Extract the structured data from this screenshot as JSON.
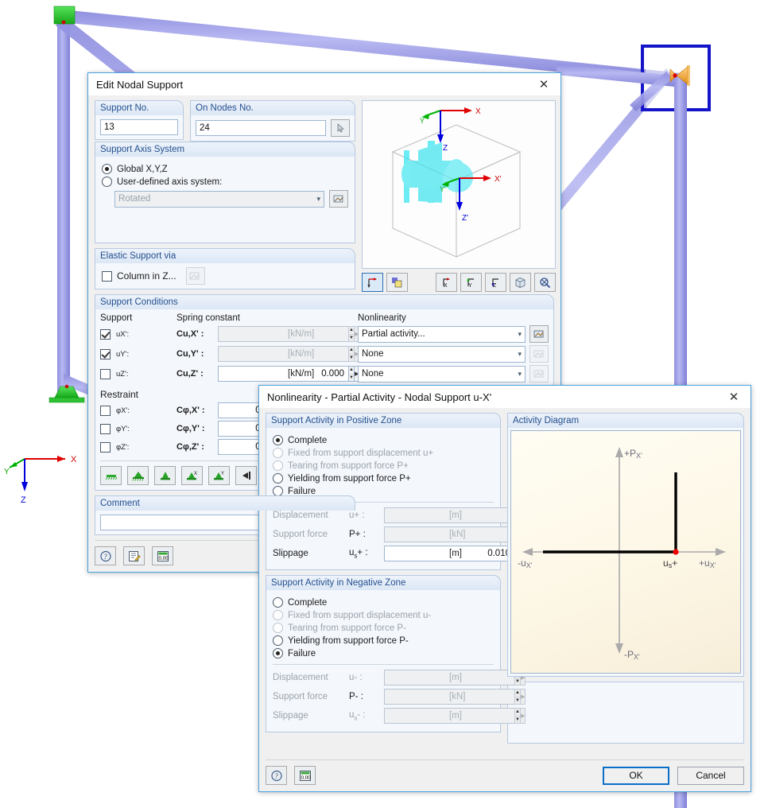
{
  "background": {
    "name": "rfem-3d-model-viewport",
    "axes": {
      "x": "X",
      "y": "Y",
      "z": "Z"
    },
    "member_color": "#9a9ae8",
    "support_color": "#22cc22",
    "highlight_box_color": "#1414c8"
  },
  "main_dialog": {
    "title": "Edit Nodal Support",
    "close_label": "✕",
    "support_no": {
      "label": "Support No.",
      "value": "13"
    },
    "on_nodes_no": {
      "label": "On Nodes No.",
      "value": "24",
      "pick_icon": "pick-node-icon"
    },
    "axis_system": {
      "legend": "Support Axis System",
      "global_label": "Global X,Y,Z",
      "global_selected": true,
      "user_label": "User-defined axis system:",
      "user_selected": false,
      "rotated_value": "Rotated",
      "edit_icon": "edit-axis-icon"
    },
    "elastic_support": {
      "legend": "Elastic Support via",
      "column_label": "Column in Z...",
      "column_checked": false,
      "edit_icon": "edit-column-icon"
    },
    "preview": {
      "view_icons": [
        "axes-view-icon",
        "render-view-icon"
      ],
      "projection_icons": [
        "view-x-icon",
        "view-y-icon",
        "view-z-icon",
        "iso-view-icon",
        "zoom-all-icon"
      ],
      "labels": {
        "x": "X",
        "y": "Y",
        "z": "Z",
        "xp": "X'",
        "yp": "Y'",
        "zp": "Z'"
      }
    },
    "support_conditions": {
      "legend": "Support Conditions",
      "col_support": "Support",
      "col_spring": "Spring constant",
      "col_nonlinearity": "Nonlinearity",
      "rows": [
        {
          "name": "uX'",
          "checked": true,
          "spring_label": "Cu,X'",
          "spring_value": "",
          "spring_enabled": false,
          "unit": "[kN/m]",
          "nonlinearity": "Partial activity...",
          "nl_button_enabled": true
        },
        {
          "name": "uY'",
          "checked": true,
          "spring_label": "Cu,Y'",
          "spring_value": "",
          "spring_enabled": false,
          "unit": "[kN/m]",
          "nonlinearity": "None",
          "nl_button_enabled": false
        },
        {
          "name": "uZ'",
          "checked": false,
          "spring_label": "Cu,Z'",
          "spring_value": "0.000",
          "spring_enabled": true,
          "unit": "[kN/m]",
          "nonlinearity": "None",
          "nl_button_enabled": false
        }
      ],
      "restraint_label": "Restraint",
      "restraint_rows": [
        {
          "name": "φX'",
          "checked": false,
          "spring_label": "Cφ,X'",
          "spring_value": "0.000"
        },
        {
          "name": "φY'",
          "checked": false,
          "spring_label": "Cφ,Y'",
          "spring_value": "0.000"
        },
        {
          "name": "φZ'",
          "checked": false,
          "spring_label": "Cφ,Z'",
          "spring_value": "0.000"
        }
      ],
      "preset_icons": [
        "support-none-icon",
        "support-fixed-icon",
        "support-hinged-icon",
        "support-roller-x-icon",
        "support-roller-y-icon",
        "support-wall-icon"
      ]
    },
    "comment": {
      "legend": "Comment",
      "value": "",
      "placeholder": ""
    },
    "footer_icons": [
      "help-icon",
      "notes-icon",
      "units-icon"
    ]
  },
  "nonlinearity_dialog": {
    "title": "Nonlinearity - Partial Activity - Nodal Support u-X'",
    "close_label": "✕",
    "positive_zone": {
      "legend": "Support Activity in Positive Zone",
      "options": [
        {
          "label": "Complete",
          "selected": true,
          "enabled": true
        },
        {
          "label": "Fixed from support displacement u+",
          "selected": false,
          "enabled": false
        },
        {
          "label": "Tearing from support force P+",
          "selected": false,
          "enabled": false
        },
        {
          "label": "Yielding from support force P+",
          "selected": false,
          "enabled": true
        },
        {
          "label": "Failure",
          "selected": false,
          "enabled": true
        }
      ],
      "fields": [
        {
          "label": "Displacement",
          "symbol": "u+",
          "colon": ":",
          "value": "",
          "unit": "[m]",
          "enabled": false
        },
        {
          "label": "Support force",
          "symbol": "P+",
          "colon": ":",
          "value": "",
          "unit": "[kN]",
          "enabled": false
        },
        {
          "label": "Slippage",
          "symbol": "us+",
          "colon": ":",
          "value": "0.010",
          "unit": "[m]",
          "enabled": true
        }
      ]
    },
    "negative_zone": {
      "legend": "Support Activity in Negative Zone",
      "options": [
        {
          "label": "Complete",
          "selected": false,
          "enabled": true
        },
        {
          "label": "Fixed from support displacement u-",
          "selected": false,
          "enabled": false
        },
        {
          "label": "Tearing from support force P-",
          "selected": false,
          "enabled": false
        },
        {
          "label": "Yielding from support force P-",
          "selected": false,
          "enabled": true
        },
        {
          "label": "Failure",
          "selected": true,
          "enabled": true
        }
      ],
      "fields": [
        {
          "label": "Displacement",
          "symbol": "u-",
          "colon": ":",
          "value": "",
          "unit": "[m]",
          "enabled": false
        },
        {
          "label": "Support force",
          "symbol": "P-",
          "colon": ":",
          "value": "",
          "unit": "[kN]",
          "enabled": false
        },
        {
          "label": "Slippage",
          "symbol": "us-",
          "colon": ":",
          "value": "",
          "unit": "[m]",
          "enabled": false
        }
      ]
    },
    "activity_diagram": {
      "legend": "Activity Diagram",
      "axis_labels": {
        "top": "+PX'",
        "bottom": "-PX'",
        "left": "-uX'",
        "right": "+uX'",
        "point": "us+"
      },
      "marker_color": "#ee0000"
    },
    "footer_icons": [
      "help-icon",
      "units-icon"
    ],
    "ok_label": "OK",
    "cancel_label": "Cancel"
  }
}
